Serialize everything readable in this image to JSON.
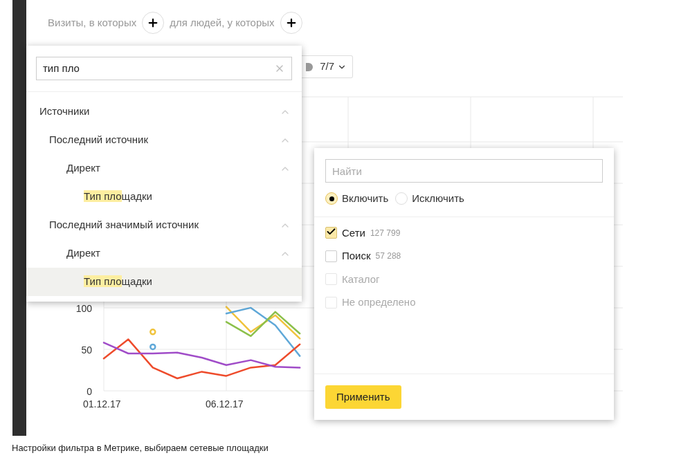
{
  "segment_bar": {
    "visits_label": "Визиты, в которых",
    "people_label": "для людей, у которых"
  },
  "series_toggle": {
    "label": "7/7"
  },
  "chart": {
    "chart_data": {
      "type": "line",
      "categories": [
        "01.12.17",
        null,
        null,
        null,
        null,
        "06.12.17",
        null,
        null,
        null,
        null,
        null,
        null,
        null,
        null,
        null,
        null,
        null,
        null,
        null,
        null,
        null,
        null
      ],
      "ylim": [
        0,
        354
      ],
      "yticks": [
        0,
        50,
        100
      ],
      "grid": true,
      "series": [
        {
          "color": "#f0c33c",
          "values": [
            null,
            null,
            71,
            null,
            null,
            101,
            71,
            91,
            63,
            null,
            null,
            null,
            null,
            null,
            null,
            null,
            null,
            null,
            null,
            null,
            null,
            null
          ]
        },
        {
          "color": "#5fa8d8",
          "values": [
            null,
            null,
            53,
            null,
            null,
            93,
            100,
            79,
            42,
            null,
            null,
            null,
            null,
            null,
            null,
            null,
            null,
            null,
            null,
            null,
            null,
            null
          ]
        },
        {
          "color": "#8cc04a",
          "values": [
            null,
            null,
            null,
            null,
            null,
            83,
            66,
            95,
            69,
            null,
            null,
            null,
            null,
            null,
            null,
            null,
            null,
            null,
            null,
            null,
            null,
            null
          ]
        },
        {
          "color": "#ee4b2b",
          "values": [
            39,
            62,
            28,
            15,
            23,
            18,
            28,
            31,
            56,
            null,
            null,
            null,
            null,
            null,
            null,
            null,
            null,
            null,
            null,
            null,
            null,
            null
          ]
        },
        {
          "color": "#a04cc8",
          "values": [
            58,
            45,
            45,
            46,
            40,
            31,
            37,
            29,
            28,
            null,
            null,
            null,
            null,
            null,
            null,
            null,
            null,
            null,
            null,
            null,
            null,
            null
          ]
        }
      ]
    }
  },
  "attribute_picker": {
    "search": {
      "value": "тип пло"
    },
    "tree": [
      {
        "label": "Источники",
        "expanded": true,
        "children": [
          {
            "label": "Последний источник",
            "expanded": true,
            "children": [
              {
                "label": "Директ",
                "expanded": true,
                "children": [
                  {
                    "match": "Тип пло",
                    "rest": "щадки",
                    "selected": false
                  }
                ]
              }
            ]
          },
          {
            "label": "Последний значимый источник",
            "expanded": true,
            "children": [
              {
                "label": "Директ",
                "expanded": true,
                "children": [
                  {
                    "match": "Тип пло",
                    "rest": "щадки",
                    "selected": true
                  }
                ]
              }
            ]
          }
        ]
      }
    ]
  },
  "value_filter": {
    "search": {
      "placeholder": "Найти"
    },
    "modes": [
      {
        "label": "Включить",
        "selected": true
      },
      {
        "label": "Исключить",
        "selected": false
      }
    ],
    "options": [
      {
        "label": "Сети",
        "count": "127 799",
        "checked": true,
        "disabled": false
      },
      {
        "label": "Поиск",
        "count": "57 288",
        "checked": false,
        "disabled": false
      },
      {
        "label": "Каталог",
        "checked": false,
        "disabled": true
      },
      {
        "label": "Не определено",
        "checked": false,
        "disabled": true
      }
    ],
    "apply_button": "Применить"
  },
  "caption": "Настройки фильтра в Метрике, выбираем сетевые площадки"
}
